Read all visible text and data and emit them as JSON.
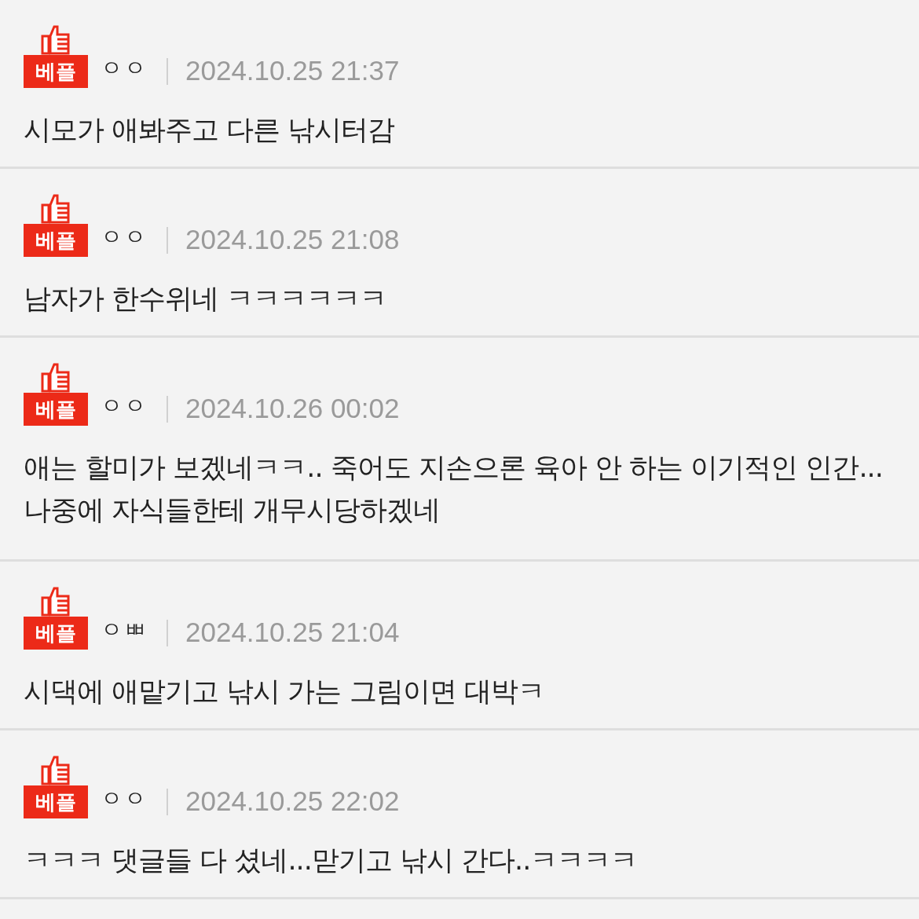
{
  "comments": [
    {
      "badge": "베플",
      "author": "ㅇㅇ",
      "date": "2024.10.25 21:37",
      "text": "시모가 애봐주고 다른 낚시터감"
    },
    {
      "badge": "베플",
      "author": "ㅇㅇ",
      "date": "2024.10.25 21:08",
      "text": "남자가 한수위네 ㅋㅋㅋㅋㅋㅋ"
    },
    {
      "badge": "베플",
      "author": "ㅇㅇ",
      "date": "2024.10.26 00:02",
      "text": "애는 할미가 보겠네ㅋㅋ.. 죽어도 지손으론 육아 안 하는 이기적인 인간... 나중에 자식들한테 개무시당하겠네"
    },
    {
      "badge": "베플",
      "author": "ㅇㅃ",
      "date": "2024.10.25 21:04",
      "text": "시댁에 애맡기고 낚시 가는 그림이면 대박ㅋ"
    },
    {
      "badge": "베플",
      "author": "ㅇㅇ",
      "date": "2024.10.25 22:02",
      "text": "ㅋㅋㅋ 댓글들 다 셨네...맏기고 낚시 간다..ㅋㅋㅋㅋ"
    }
  ]
}
